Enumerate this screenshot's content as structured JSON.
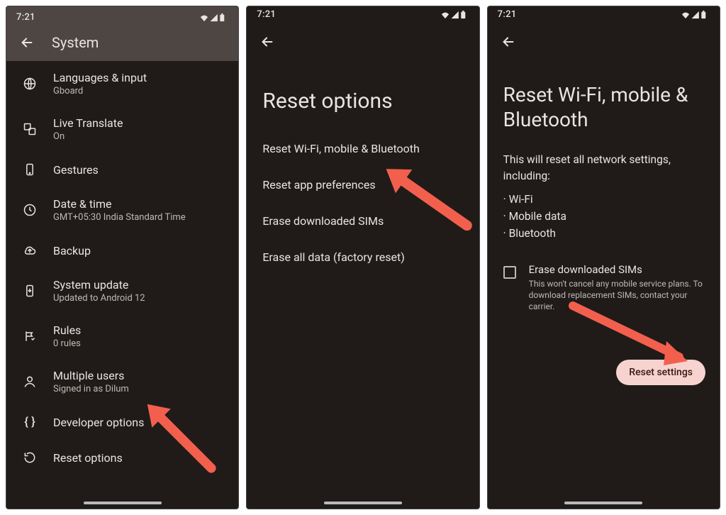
{
  "statusbar": {
    "time": "7:21"
  },
  "screen1": {
    "title": "System",
    "items": [
      {
        "icon": "globe-icon",
        "label": "Languages & input",
        "sub": "Gboard"
      },
      {
        "icon": "translate-icon",
        "label": "Live Translate",
        "sub": "On"
      },
      {
        "icon": "gesture-icon",
        "label": "Gestures",
        "sub": ""
      },
      {
        "icon": "clock-icon",
        "label": "Date & time",
        "sub": "GMT+05:30 India Standard Time"
      },
      {
        "icon": "cloud-icon",
        "label": "Backup",
        "sub": ""
      },
      {
        "icon": "update-icon",
        "label": "System update",
        "sub": "Updated to Android 12"
      },
      {
        "icon": "rules-icon",
        "label": "Rules",
        "sub": "0 rules"
      },
      {
        "icon": "users-icon",
        "label": "Multiple users",
        "sub": "Signed in as Dilum"
      },
      {
        "icon": "braces-icon",
        "label": "Developer options",
        "sub": ""
      },
      {
        "icon": "reset-icon",
        "label": "Reset options",
        "sub": ""
      }
    ]
  },
  "screen2": {
    "title": "Reset options",
    "options": [
      "Reset Wi-Fi, mobile & Bluetooth",
      "Reset app preferences",
      "Erase downloaded SIMs",
      "Erase all data (factory reset)"
    ]
  },
  "screen3": {
    "title": "Reset Wi-Fi, mobile & Bluetooth",
    "body": "This will reset all network settings, including:",
    "bullets": [
      "Wi-Fi",
      "Mobile data",
      "Bluetooth"
    ],
    "checkbox": {
      "label": "Erase downloaded SIMs",
      "sub": "This won't cancel any mobile service plans. To download replacement SIMs, contact your carrier."
    },
    "button": "Reset settings"
  }
}
